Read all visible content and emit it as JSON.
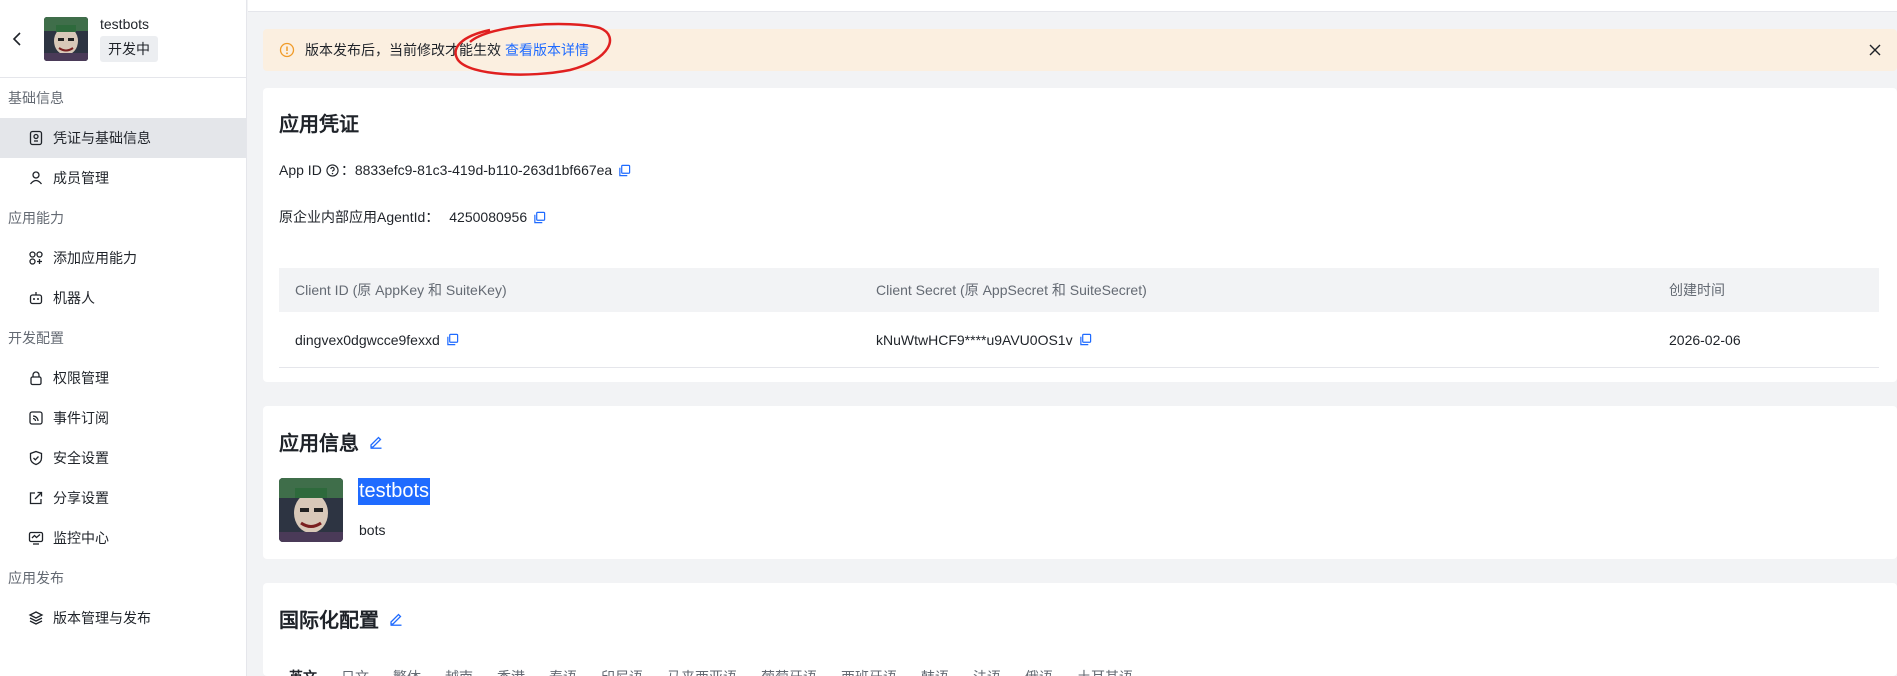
{
  "app": {
    "name": "testbots",
    "status": "开发中",
    "description": "bots"
  },
  "sidebar": {
    "groups": [
      {
        "title": "基础信息",
        "items": [
          {
            "label": "凭证与基础信息",
            "icon": "credential-icon",
            "active": true
          },
          {
            "label": "成员管理",
            "icon": "user-icon"
          }
        ]
      },
      {
        "title": "应用能力",
        "items": [
          {
            "label": "添加应用能力",
            "icon": "apps-icon"
          },
          {
            "label": "机器人",
            "icon": "robot-icon"
          }
        ]
      },
      {
        "title": "开发配置",
        "items": [
          {
            "label": "权限管理",
            "icon": "lock-icon"
          },
          {
            "label": "事件订阅",
            "icon": "rss-icon"
          },
          {
            "label": "安全设置",
            "icon": "shield-icon"
          },
          {
            "label": "分享设置",
            "icon": "share-icon"
          },
          {
            "label": "监控中心",
            "icon": "monitor-icon"
          }
        ]
      },
      {
        "title": "应用发布",
        "items": [
          {
            "label": "版本管理与发布",
            "icon": "layers-icon"
          }
        ]
      }
    ]
  },
  "notice": {
    "text": "版本发布后，当前修改才能生效",
    "link": "查看版本详情"
  },
  "credentials": {
    "title": "应用凭证",
    "app_id_label": "App ID",
    "app_id_sep": "：",
    "app_id_value": "8833efc9-81c3-419d-b110-263d1bf667ea",
    "agent_label": "原企业内部应用AgentId：",
    "agent_value": "4250080956",
    "table": {
      "headers": [
        "Client ID (原 AppKey 和 SuiteKey)",
        "Client Secret (原 AppSecret 和 SuiteSecret)",
        "创建时间"
      ],
      "row": {
        "client_id": "dingvex0dgwcce9fexxd",
        "client_secret": "kNuWtwHCF9****u9AVU0OS1v",
        "created": "2026-02-06"
      }
    }
  },
  "app_info": {
    "title": "应用信息"
  },
  "i18n": {
    "title": "国际化配置",
    "tabs": [
      "英文",
      "日文",
      "繁体",
      "越南",
      "香港",
      "泰语",
      "印尼语",
      "马来西亚语",
      "葡萄牙语",
      "西班牙语",
      "韩语",
      "法语",
      "俄语",
      "土耳其语"
    ]
  },
  "colors": {
    "accent": "#1f6bff",
    "notice_bg": "#fbefe0",
    "warn_icon": "#f09b29",
    "annotation": "#e02020"
  }
}
